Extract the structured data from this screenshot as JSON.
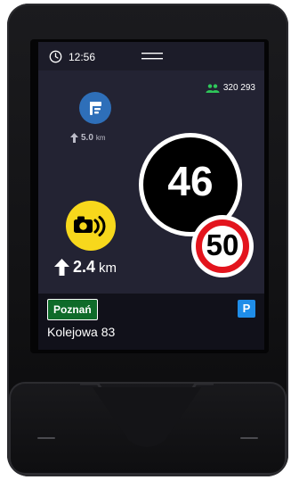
{
  "status_bar": {
    "time": "12:56",
    "clock_icon": "clock-icon",
    "menu_icon": "hamburger-menu-icon"
  },
  "community": {
    "icon": "users-icon",
    "count": "320 293",
    "color": "#2fc85a"
  },
  "poi": {
    "icon": "poi-marker-icon",
    "badge_color": "#2e6fb9",
    "distance": "5.0",
    "unit": "km"
  },
  "speed": {
    "current": "46",
    "limit": "50",
    "limit_ring_color": "#e3141d"
  },
  "speed_camera": {
    "icon": "speed-camera-icon",
    "badge_color": "#f7d81c",
    "distance": "2.4",
    "unit": "km"
  },
  "location": {
    "city": "Poznań",
    "city_badge_color": "#0f6b2a",
    "street": "Kolejowa 83",
    "parking_label": "P",
    "parking_color": "#1f8de8"
  }
}
